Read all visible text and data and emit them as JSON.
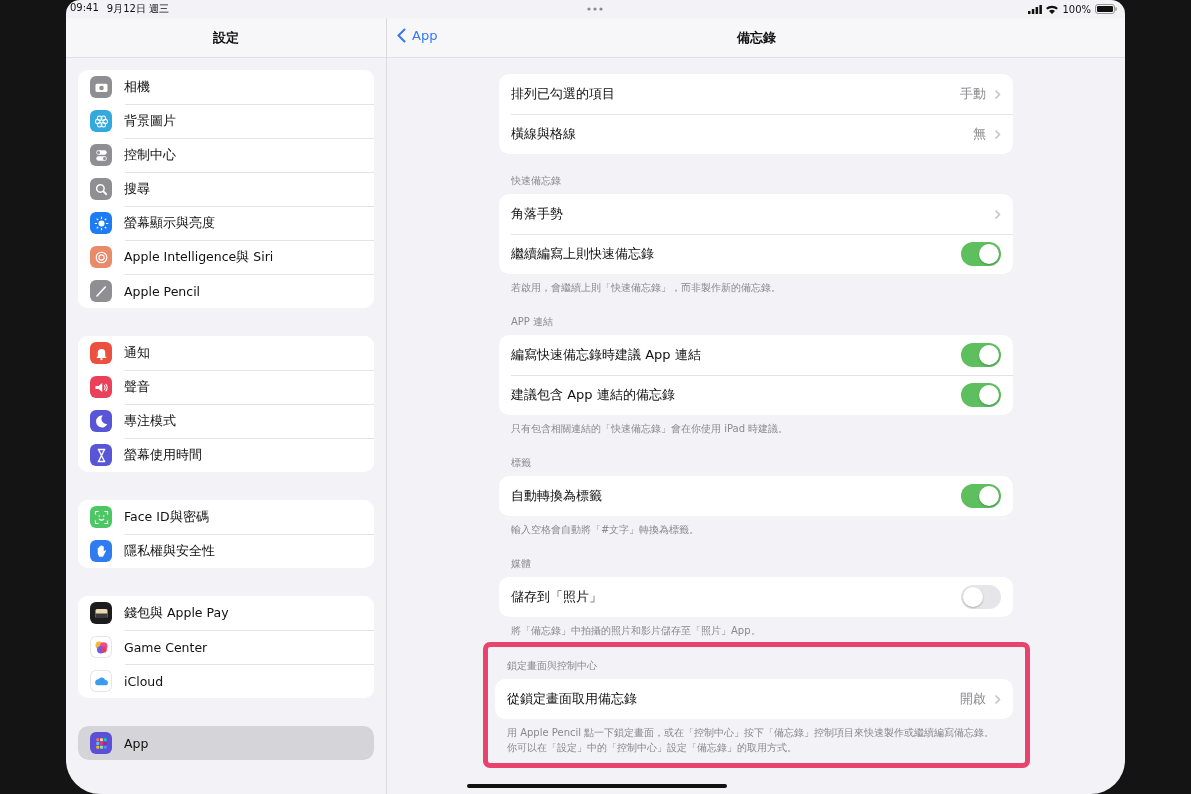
{
  "status_bar": {
    "time": "09:41",
    "date": "9月12日 週三",
    "battery": "100%"
  },
  "sidebar": {
    "title": "設定",
    "groups": [
      {
        "items": [
          {
            "label": "相機",
            "color": "#8e8e93",
            "selected": false
          },
          {
            "label": "背景圖片",
            "color": "#34aadc",
            "selected": false
          },
          {
            "label": "控制中心",
            "color": "#8e8e93",
            "selected": false
          },
          {
            "label": "搜尋",
            "color": "#8e8e93",
            "selected": false
          },
          {
            "label": "螢幕顯示與亮度",
            "color": "#1c7cf4",
            "selected": false
          },
          {
            "label": "Apple Intelligence與 Siri",
            "color": "#e98b6a",
            "selected": false
          },
          {
            "label": "Apple Pencil",
            "color": "#8e8e93",
            "selected": false
          }
        ]
      },
      {
        "items": [
          {
            "label": "通知",
            "color": "#ec5140",
            "selected": false
          },
          {
            "label": "聲音",
            "color": "#e9415a",
            "selected": false
          },
          {
            "label": "專注模式",
            "color": "#5856d6",
            "selected": false
          },
          {
            "label": "螢幕使用時間",
            "color": "#5856d6",
            "selected": false
          }
        ]
      },
      {
        "items": [
          {
            "label": "Face ID與密碼",
            "color": "#4cc764",
            "selected": false
          },
          {
            "label": "隱私權與安全性",
            "color": "#2f7bf0",
            "selected": false
          }
        ]
      },
      {
        "items": [
          {
            "label": "錢包與 Apple Pay",
            "color": "#1c1c1e",
            "selected": false
          },
          {
            "label": "Game Center",
            "color": "#ffffff",
            "selected": false
          },
          {
            "label": "iCloud",
            "color": "#ffffff",
            "selected": false
          }
        ]
      },
      {
        "items": [
          {
            "label": "App",
            "color": "#5b4fd8",
            "selected": true
          }
        ]
      }
    ]
  },
  "detail": {
    "back": "App",
    "title": "備忘錄",
    "sections": [
      {
        "rows": [
          {
            "kind": "link",
            "label": "排列已勾選的項目",
            "value": "手動"
          },
          {
            "kind": "link",
            "label": "橫線與格線",
            "value": "無"
          }
        ]
      },
      {
        "header": "快速備忘錄",
        "rows": [
          {
            "kind": "link",
            "label": "角落手勢"
          },
          {
            "kind": "toggle",
            "label": "繼續編寫上則快速備忘錄",
            "on": true
          }
        ],
        "footer": "若啟用，會繼續上則「快速備忘錄」，而非製作新的備忘錄。"
      },
      {
        "header": "APP 連結",
        "rows": [
          {
            "kind": "toggle",
            "label": "編寫快速備忘錄時建議 App 連結",
            "on": true
          },
          {
            "kind": "toggle",
            "label": "建議包含 App 連結的備忘錄",
            "on": true
          }
        ],
        "footer": "只有包含相關連結的「快速備忘錄」會在你使用 iPad 時建議。"
      },
      {
        "header": "標籤",
        "rows": [
          {
            "kind": "toggle",
            "label": "自動轉換為標籤",
            "on": true
          }
        ],
        "footer": "輸入空格會自動將「#文字」轉換為標籤。"
      },
      {
        "header": "媒體",
        "rows": [
          {
            "kind": "toggle",
            "label": "儲存到「照片」",
            "on": false
          }
        ],
        "footer": "將「備忘錄」中拍攝的照片和影片儲存至「照片」App。"
      },
      {
        "header": "鎖定畫面與控制中心",
        "highlighted": true,
        "rows": [
          {
            "kind": "link",
            "label": "從鎖定畫面取用備忘錄",
            "value": "開啟"
          }
        ],
        "footer": "用 Apple Pencil 點一下鎖定畫面，或在「控制中心」按下「備忘錄」控制項目來快速製作或繼續編寫備忘錄。你可以在「設定」中的「控制中心」設定「備忘錄」的取用方式。"
      }
    ]
  }
}
